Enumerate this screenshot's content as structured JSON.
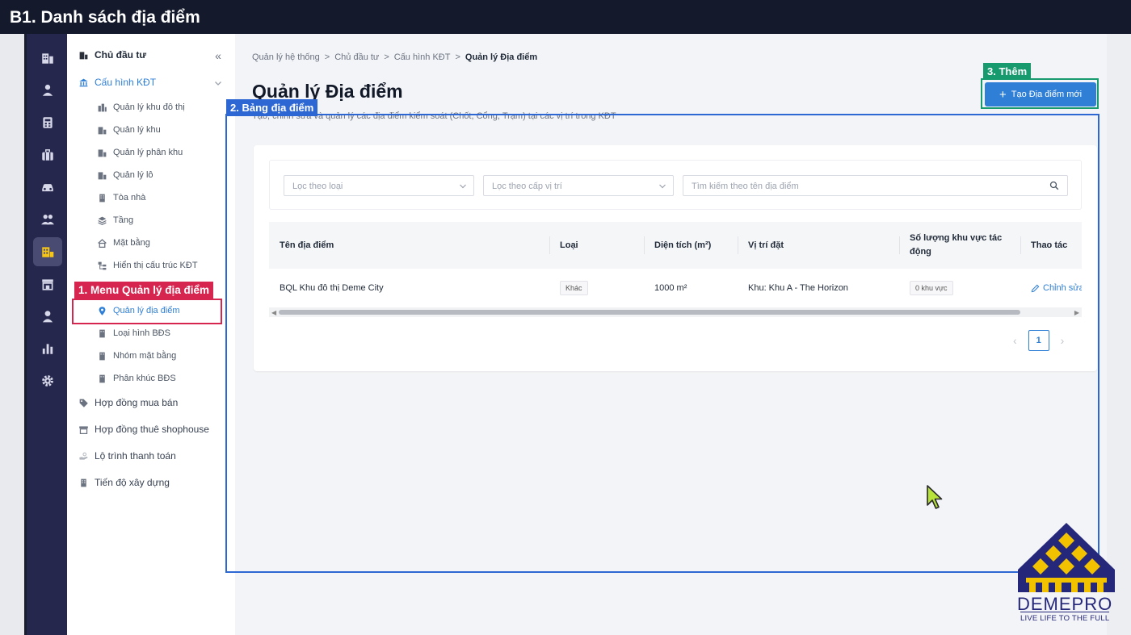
{
  "banner": {
    "title": "B1. Danh sách địa điểm"
  },
  "menu": {
    "collapse_label": "«",
    "items": [
      {
        "label": "Chủ đầu tư"
      },
      {
        "label": "Cấu hình KĐT"
      },
      {
        "label": "Quản lý khu đô thị"
      },
      {
        "label": "Quản lý khu"
      },
      {
        "label": "Quản lý phân khu"
      },
      {
        "label": "Quản lý lô"
      },
      {
        "label": "Tòa nhà"
      },
      {
        "label": "Tầng"
      },
      {
        "label": "Mặt bằng"
      },
      {
        "label": "Hiển thị cấu trúc KĐT"
      },
      {
        "label": "Quản lý địa điểm"
      },
      {
        "label": "Loại hình BĐS"
      },
      {
        "label": "Nhóm mặt bằng"
      },
      {
        "label": "Phân khúc BĐS"
      },
      {
        "label": "Hợp đồng mua bán"
      },
      {
        "label": "Hợp đồng thuê shophouse"
      },
      {
        "label": "Lộ trình thanh toán"
      },
      {
        "label": "Tiến độ xây dựng"
      }
    ]
  },
  "breadcrumb": {
    "items": [
      "Quản lý hệ thống",
      "Chủ đầu tư",
      "Cấu hình KĐT",
      "Quản lý Địa điểm"
    ],
    "separator": ">"
  },
  "page": {
    "title": "Quản lý Địa điểm",
    "subtitle": "Tạo, chỉnh sửa và quản lý các địa điểm kiểm soát (Chốt, Cổng, Trạm) tại các vị trí trong KĐT",
    "create_button": "Tạo Địa điểm mới"
  },
  "filters": {
    "type_placeholder": "Lọc theo loại",
    "level_placeholder": "Lọc theo cấp vị trí",
    "search_placeholder": "Tìm kiếm theo tên địa điểm"
  },
  "table": {
    "headers": [
      "Tên địa điểm",
      "Loại",
      "Diện tích (m²)",
      "Vị trí đặt",
      "Số lượng khu vực tác động",
      "Thao tác"
    ],
    "rows": [
      {
        "name": "BQL Khu đô thị Deme City",
        "type": "Khác",
        "area": "1000 m²",
        "location": "Khu: Khu A - The Horizon",
        "zones": "0 khu vực",
        "action": "Chỉnh sửa"
      }
    ]
  },
  "pagination": {
    "current_page": "1"
  },
  "annotations": {
    "menu": "1. Menu Quản lý địa điểm",
    "table": "2. Bảng địa điểm",
    "add": "3. Thêm"
  },
  "logo": {
    "name": "DEMEPRO",
    "tagline": "LIVE LIFE TO THE FULL"
  },
  "colors": {
    "accent": "#2f7fd6",
    "rail": "#26274d",
    "ann_red": "#d6254f",
    "ann_blue": "#2d67d4",
    "ann_green": "#169a6e",
    "logo_blue": "#25277a",
    "logo_yellow": "#f2c200"
  }
}
